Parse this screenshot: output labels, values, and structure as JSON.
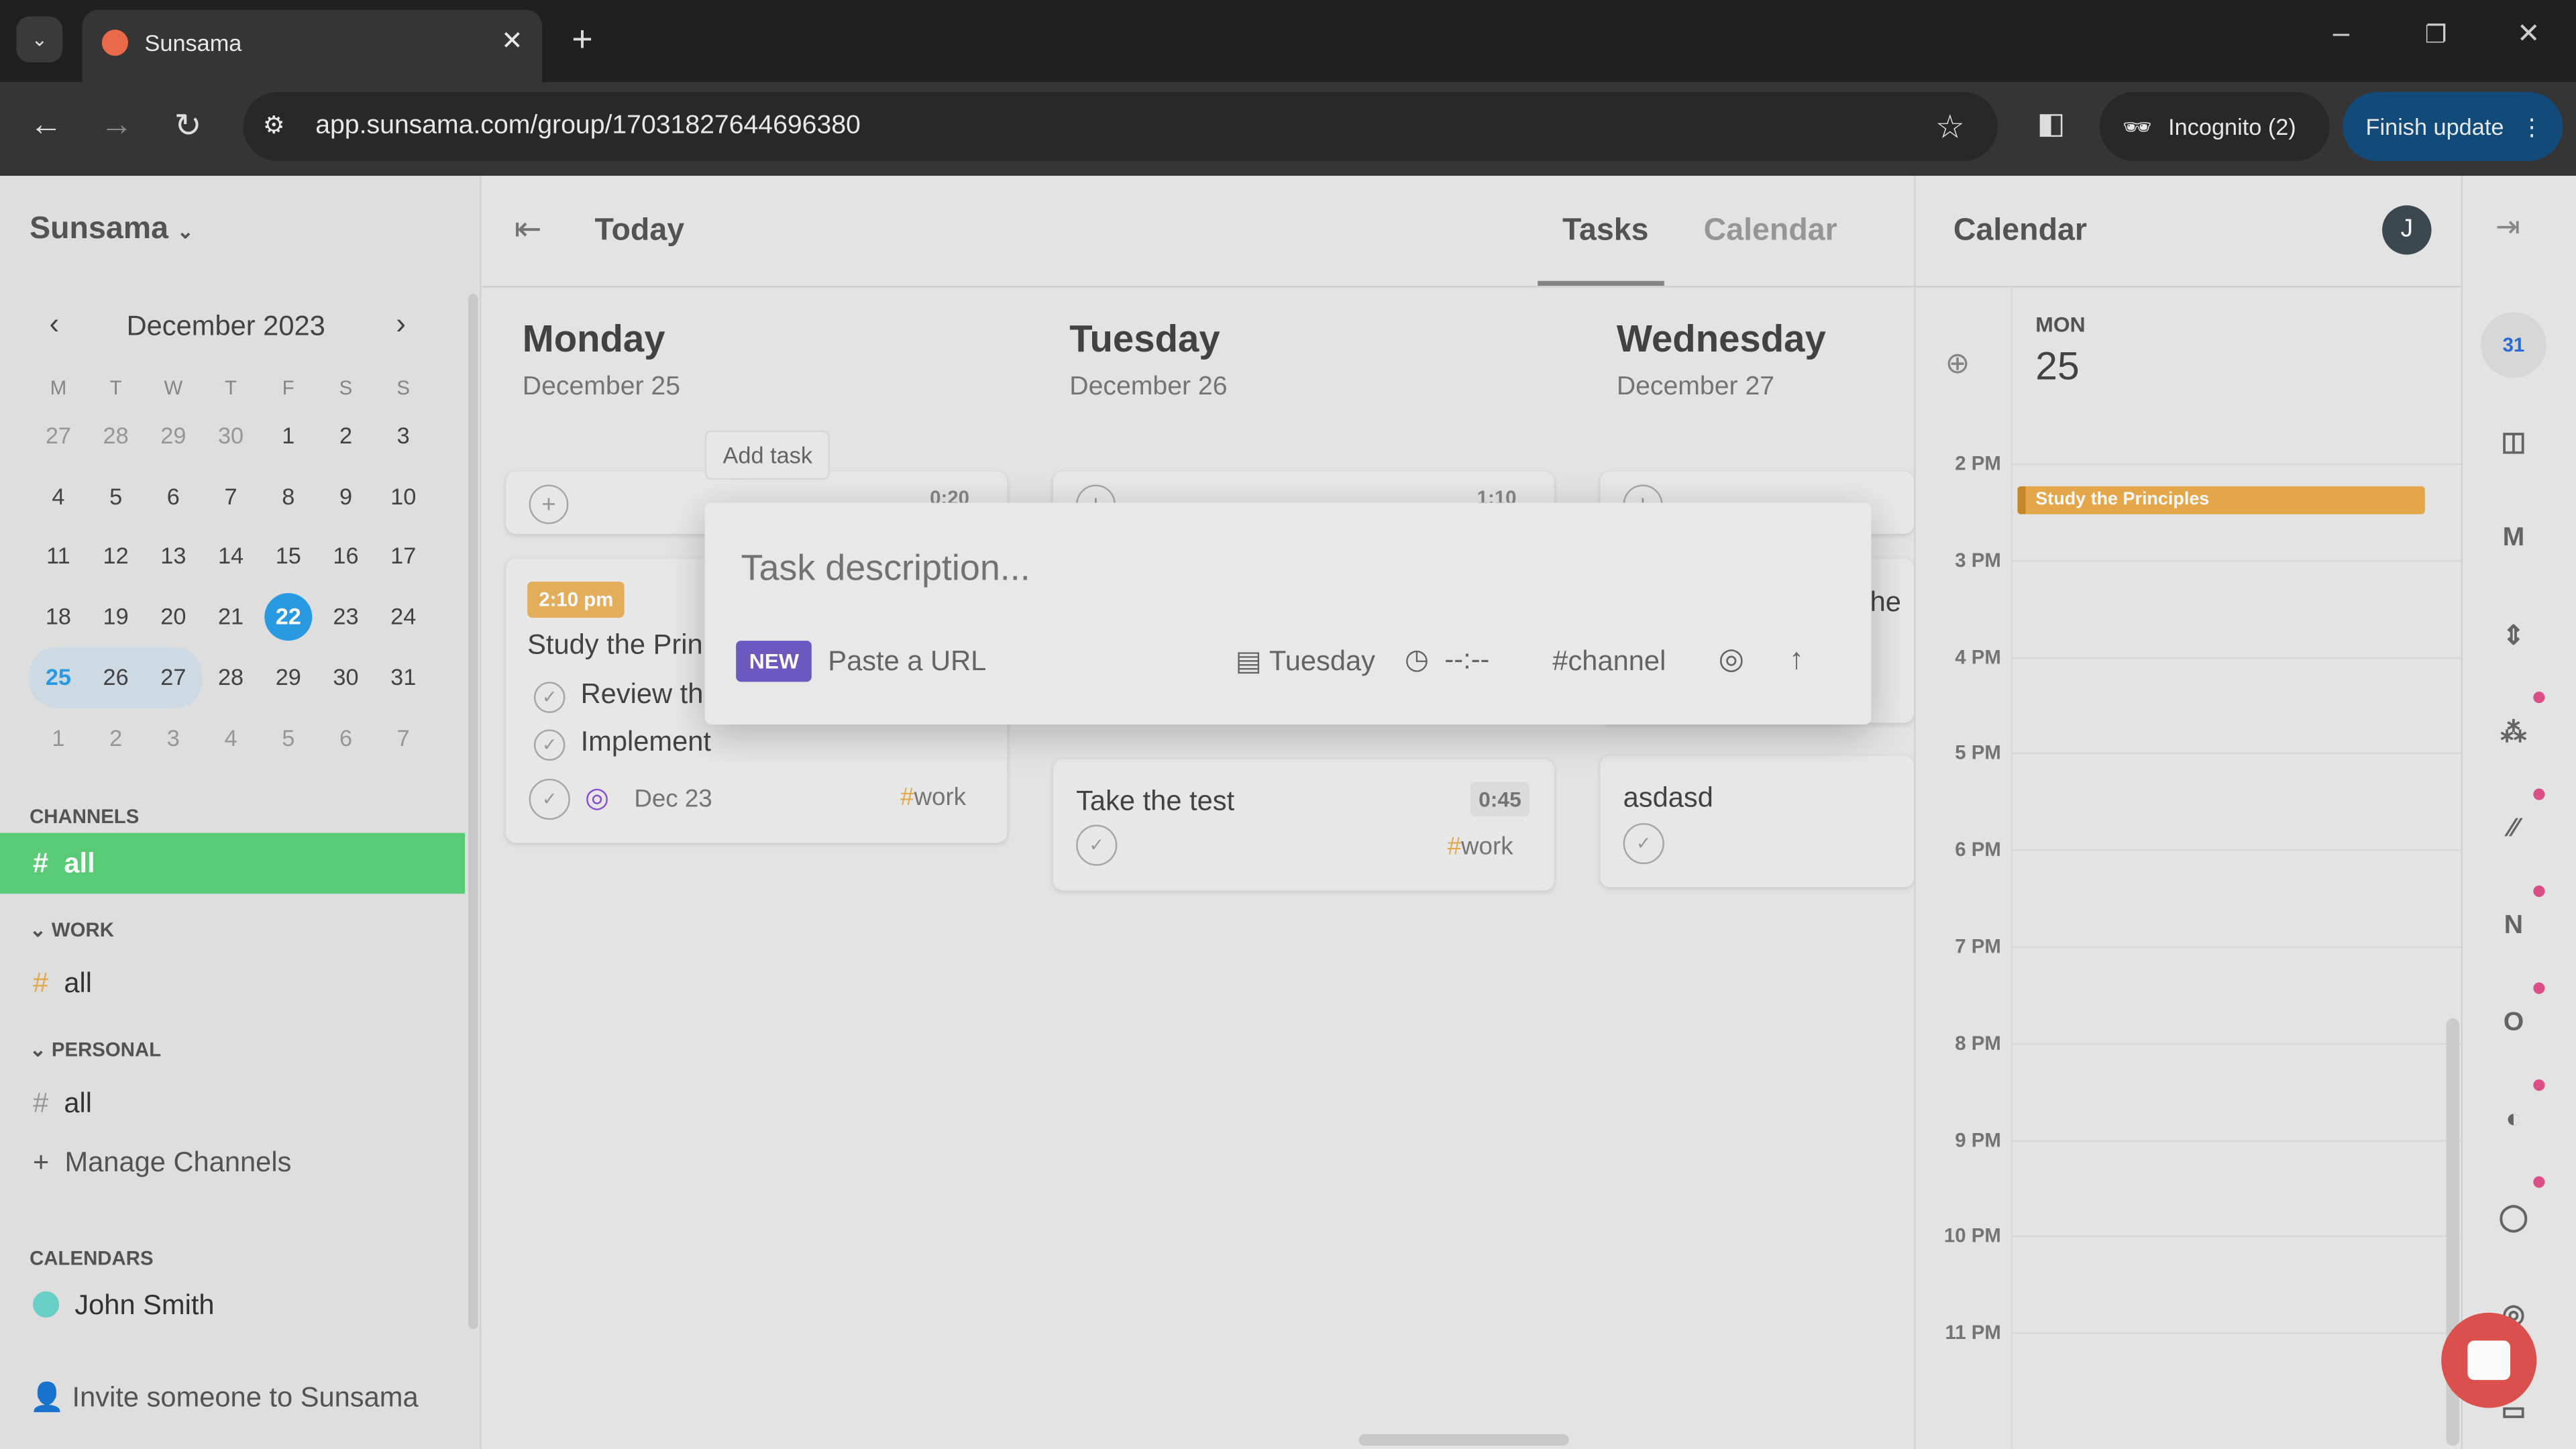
{
  "browser": {
    "tab_title": "Sunsama",
    "url": "app.sunsama.com/group/17031827644696380",
    "profile": "Incognito (2)",
    "update_button": "Finish update"
  },
  "sidebar": {
    "workspace": "Sunsama",
    "month": "December 2023",
    "weekdays": [
      "M",
      "T",
      "W",
      "T",
      "F",
      "S",
      "S"
    ],
    "weeks": [
      [
        "27",
        "28",
        "29",
        "30",
        "1",
        "2",
        "3"
      ],
      [
        "4",
        "5",
        "6",
        "7",
        "8",
        "9",
        "10"
      ],
      [
        "11",
        "12",
        "13",
        "14",
        "15",
        "16",
        "17"
      ],
      [
        "18",
        "19",
        "20",
        "21",
        "22",
        "23",
        "24"
      ],
      [
        "25",
        "26",
        "27",
        "28",
        "29",
        "30",
        "31"
      ],
      [
        "1",
        "2",
        "3",
        "4",
        "5",
        "6",
        "7"
      ]
    ],
    "today": "22",
    "selected_range": [
      "25",
      "26",
      "27"
    ],
    "channels_header": "CHANNELS",
    "channels_all": "all",
    "work_header": "WORK",
    "work_all": "all",
    "personal_header": "PERSONAL",
    "personal_all": "all",
    "manage_channels": "Manage Channels",
    "calendars_header": "CALENDARS",
    "calendar_user": "John Smith",
    "invite": "Invite someone to Sunsama"
  },
  "header": {
    "title": "Today",
    "tabs": [
      {
        "label": "Tasks",
        "active": true
      },
      {
        "label": "Calendar",
        "active": false
      }
    ]
  },
  "days": [
    {
      "name": "Monday",
      "date": "December 25",
      "total": "0:20"
    },
    {
      "name": "Tuesday",
      "date": "December 26",
      "total": "1:10"
    },
    {
      "name": "Wednesday",
      "date": "December 27",
      "total": ""
    }
  ],
  "tooltip": "Add task",
  "monday_task": {
    "time_badge": "2:10 pm",
    "title": "Study the Prin",
    "subtasks": [
      "Review th",
      "Implement"
    ],
    "due": "Dec 23",
    "channel": "work"
  },
  "tuesday_task": {
    "title": "Take the test",
    "duration": "0:45",
    "channel": "work"
  },
  "wednesday_task": {
    "title": "asdasd",
    "partial": "Che"
  },
  "add_task_modal": {
    "placeholder": "Task description...",
    "new_badge": "NEW",
    "paste_url": "Paste a URL",
    "day": "Tuesday",
    "time": "--:--",
    "channel": "channel"
  },
  "calendar_panel": {
    "title": "Calendar",
    "avatar": "J",
    "day_label": "MON",
    "day_number": "25",
    "hours": [
      "2 PM",
      "3 PM",
      "4 PM",
      "5 PM",
      "6 PM",
      "7 PM",
      "8 PM",
      "9 PM",
      "10 PM",
      "11 PM"
    ],
    "event": {
      "title": "Study the Principles",
      "color": "#e8aa4a"
    }
  },
  "rail_icons": [
    "google-calendar-icon",
    "trello-icon",
    "gmail-icon",
    "jira-icon",
    "asana-icon",
    "clickup-icon",
    "notion-icon",
    "outlook-icon",
    "linear-icon",
    "github-icon",
    "goal-icon",
    "archive-icon"
  ],
  "colors": {
    "accent_green": "#5bd07a",
    "today_blue": "#2a9de6",
    "new_purple": "#6f5bc4",
    "work_orange": "#e8aa4a",
    "chat_red": "#e0524e"
  }
}
